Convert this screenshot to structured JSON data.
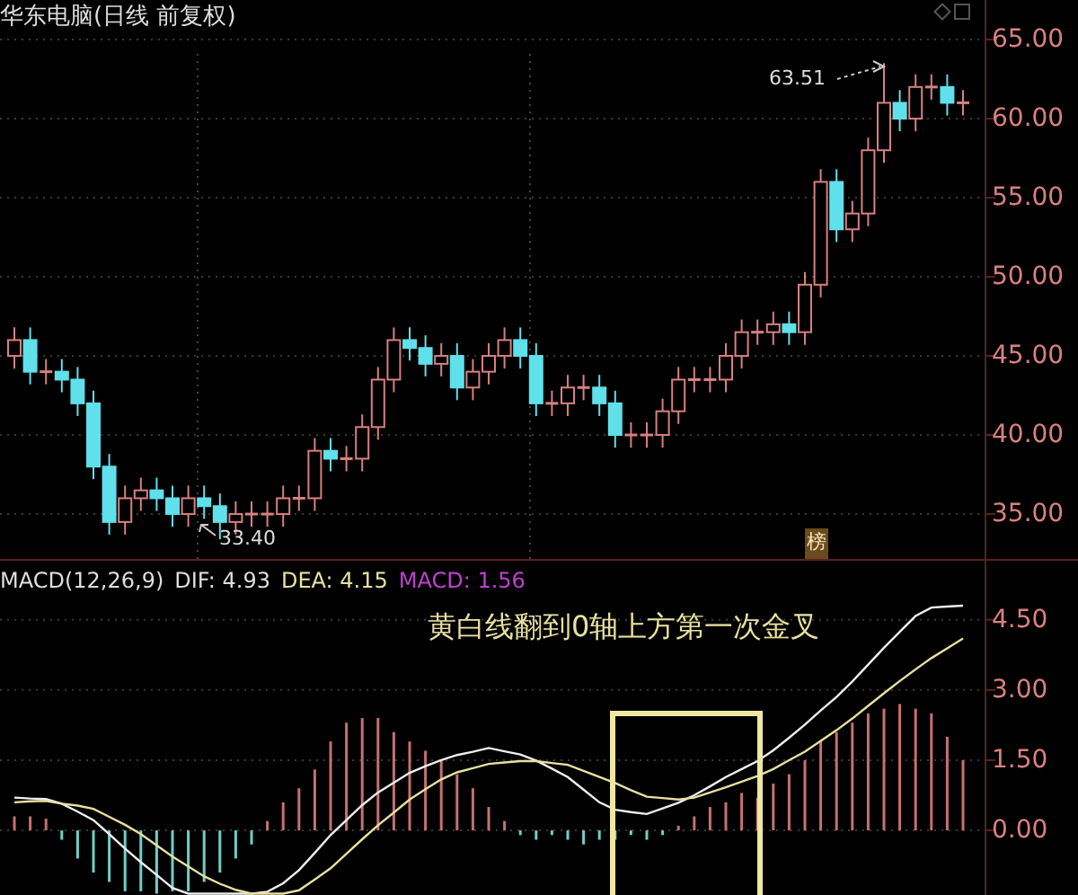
{
  "title": "华东电脑(日线 前复权)",
  "chart_data": {
    "type": "candlestick",
    "grid": true,
    "ylim": [
      32.05,
      67.5
    ],
    "ohlc": [
      [
        45,
        46.8,
        44.2,
        46
      ],
      [
        46,
        46.8,
        43.2,
        44
      ],
      [
        44,
        44.8,
        43.2,
        44
      ],
      [
        44,
        44.8,
        42.7,
        43.5
      ],
      [
        43.5,
        44.3,
        41.2,
        42
      ],
      [
        42,
        42.8,
        37.2,
        38
      ],
      [
        38,
        38.8,
        33.7,
        34.5
      ],
      [
        34.5,
        36.8,
        33.7,
        36
      ],
      [
        36,
        37.3,
        35.2,
        36.5
      ],
      [
        36.5,
        37.3,
        35.2,
        36
      ],
      [
        36,
        36.8,
        34.2,
        35
      ],
      [
        35,
        36.8,
        34.2,
        36
      ],
      [
        36,
        36.8,
        34.7,
        35.5
      ],
      [
        35.5,
        36.3,
        33.4,
        34.5
      ],
      [
        34.5,
        35.8,
        33.7,
        35
      ],
      [
        35,
        35.8,
        34.2,
        35
      ],
      [
        35,
        35.8,
        34.2,
        35
      ],
      [
        35,
        36.8,
        34.2,
        36
      ],
      [
        36,
        36.8,
        35.2,
        36
      ],
      [
        36,
        39.8,
        35.2,
        39
      ],
      [
        39,
        39.8,
        37.7,
        38.5
      ],
      [
        38.5,
        39.3,
        37.7,
        38.5
      ],
      [
        38.5,
        41.3,
        37.7,
        40.5
      ],
      [
        40.5,
        44.3,
        39.7,
        43.5
      ],
      [
        43.5,
        46.8,
        42.7,
        46
      ],
      [
        46,
        46.8,
        44.7,
        45.5
      ],
      [
        45.5,
        46.3,
        43.7,
        44.5
      ],
      [
        44.5,
        45.8,
        43.7,
        45
      ],
      [
        45,
        45.8,
        42.2,
        43
      ],
      [
        43,
        44.8,
        42.2,
        44
      ],
      [
        44,
        45.8,
        43.2,
        45
      ],
      [
        45,
        46.8,
        44.2,
        46
      ],
      [
        46,
        46.8,
        44.2,
        45
      ],
      [
        45,
        45.8,
        41.2,
        42
      ],
      [
        42,
        42.8,
        41.2,
        42
      ],
      [
        42,
        43.8,
        41.2,
        43
      ],
      [
        43,
        43.8,
        42.2,
        43
      ],
      [
        43,
        43.8,
        41.2,
        42
      ],
      [
        42,
        42.8,
        39.2,
        40
      ],
      [
        40,
        40.8,
        39.2,
        40
      ],
      [
        40,
        40.8,
        39.2,
        40
      ],
      [
        40,
        42.3,
        39.2,
        41.5
      ],
      [
        41.5,
        44.3,
        40.7,
        43.5
      ],
      [
        43.5,
        44.3,
        42.7,
        43.5
      ],
      [
        43.5,
        44.3,
        42.7,
        43.5
      ],
      [
        43.5,
        45.8,
        42.7,
        45
      ],
      [
        45,
        47.3,
        44.2,
        46.5
      ],
      [
        46.5,
        47.3,
        45.7,
        46.5
      ],
      [
        46.5,
        47.8,
        45.7,
        47
      ],
      [
        47,
        47.8,
        45.7,
        46.5
      ],
      [
        46.5,
        50.3,
        45.7,
        49.5
      ],
      [
        49.5,
        56.8,
        48.7,
        56
      ],
      [
        56,
        56.8,
        52.2,
        53
      ],
      [
        53,
        54.8,
        52.2,
        54
      ],
      [
        54,
        58.8,
        53.2,
        58
      ],
      [
        58,
        63.51,
        57.2,
        61
      ],
      [
        61,
        61.8,
        59.2,
        60
      ],
      [
        60,
        62.8,
        59.2,
        62
      ],
      [
        62,
        62.8,
        61.2,
        62
      ],
      [
        62,
        62.8,
        60.2,
        61
      ],
      [
        61,
        61.8,
        60.2,
        61
      ]
    ],
    "yticks": [
      {
        "value": 65,
        "label": "65.00"
      },
      {
        "value": 60,
        "label": "60.00"
      },
      {
        "value": 55,
        "label": "55.00"
      },
      {
        "value": 50,
        "label": "50.00"
      },
      {
        "value": 45,
        "label": "45.00"
      },
      {
        "value": 40,
        "label": "40.00"
      },
      {
        "value": 35,
        "label": "35.00"
      }
    ]
  },
  "high_marker": "63.51",
  "low_marker": "33.40",
  "badge": "榜",
  "macd": {
    "label": "MACD(12,26,9)",
    "dif": "DIF: 4.93",
    "dea": "DEA: 4.15",
    "value": "MACD: 1.56",
    "note": "黄白线翻到0轴上方第一次金叉",
    "chart_data": {
      "type": "line",
      "grid": true,
      "ylim": [
        -1.38,
        5.76
      ],
      "yticks": [
        {
          "value": 4.5,
          "label": "4.50"
        },
        {
          "value": 3,
          "label": "3.00"
        },
        {
          "value": 1.5,
          "label": "1.50"
        },
        {
          "value": 0,
          "label": "0.00"
        }
      ],
      "series": [
        {
          "color": "#eeeeee",
          "values": [
            0.7,
            0.68,
            0.67,
            0.57,
            0.4,
            0.22,
            -0.08,
            -0.39,
            -0.68,
            -0.95,
            -1.23,
            -1.35,
            -1.35,
            -1.35,
            -1.35,
            -1.35,
            -1.31,
            -1.13,
            -0.85,
            -0.48,
            -0.1,
            0.22,
            0.54,
            0.81,
            1.02,
            1.23,
            1.37,
            1.5,
            1.61,
            1.68,
            1.76,
            1.69,
            1.62,
            1.49,
            1.32,
            1.14,
            0.87,
            0.6,
            0.44,
            0.39,
            0.35,
            0.47,
            0.59,
            0.75,
            0.94,
            1.14,
            1.31,
            1.48,
            1.71,
            1.98,
            2.26,
            2.56,
            2.85,
            3.18,
            3.54,
            3.9,
            4.24,
            4.58,
            4.76,
            4.78,
            4.8
          ]
        },
        {
          "color": "#e8e0a0",
          "values": [
            0.6,
            0.62,
            0.63,
            0.57,
            0.53,
            0.46,
            0.29,
            0.12,
            -0.08,
            -0.32,
            -0.56,
            -0.77,
            -0.98,
            -1.14,
            -1.27,
            -1.35,
            -1.35,
            -1.35,
            -1.28,
            -1.05,
            -0.81,
            -0.5,
            -0.19,
            0.11,
            0.38,
            0.66,
            0.88,
            1.09,
            1.24,
            1.33,
            1.42,
            1.45,
            1.48,
            1.48,
            1.44,
            1.4,
            1.27,
            1.14,
            1.01,
            0.86,
            0.72,
            0.69,
            0.66,
            0.7,
            0.81,
            0.92,
            1.04,
            1.16,
            1.31,
            1.5,
            1.68,
            1.91,
            2.14,
            2.39,
            2.66,
            2.93,
            3.19,
            3.44,
            3.68,
            3.89,
            4.1
          ]
        }
      ]
    }
  }
}
